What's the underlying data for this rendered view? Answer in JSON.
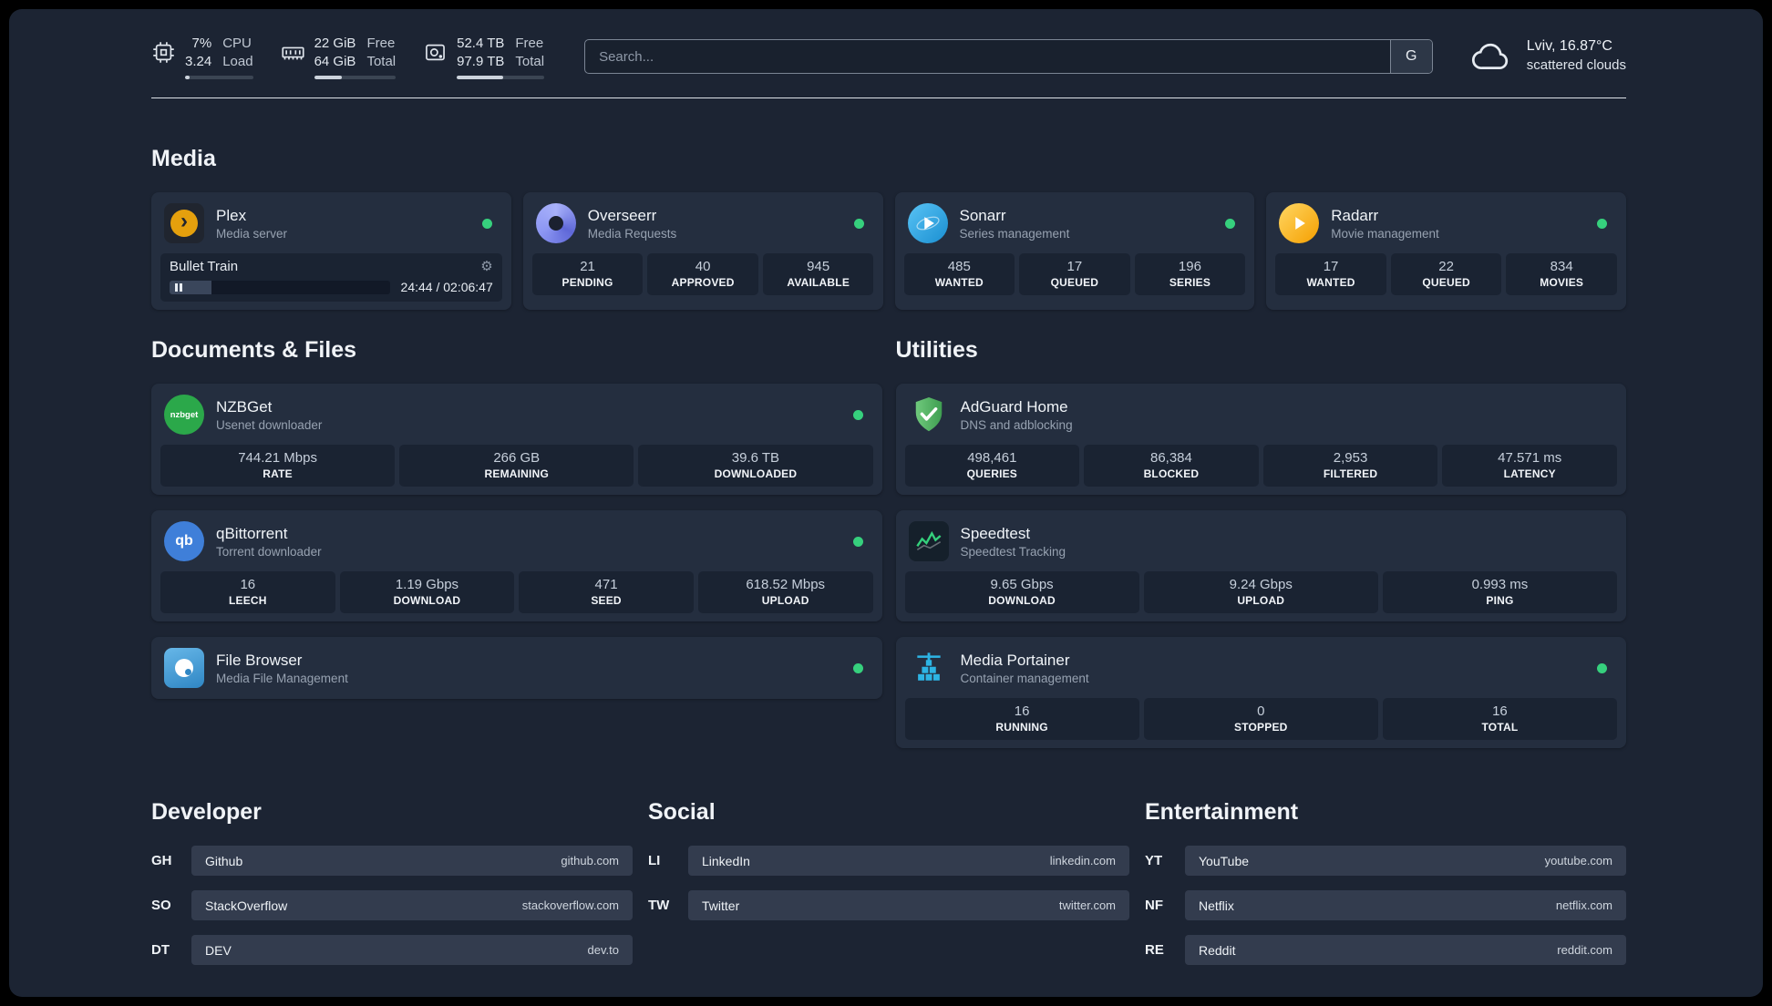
{
  "icons": {
    "plex_chevron": "›",
    "gear": "⚙"
  },
  "colors": {
    "status_online": "#36d07d",
    "plex_accent": "#e5a00d",
    "background": "#1c2433",
    "card": "#242e3f"
  },
  "topbar": {
    "cpu": {
      "value_top": "7%",
      "value_bottom": "3.24",
      "label_top": "CPU",
      "label_bottom": "Load",
      "bar_percent": 7
    },
    "memory": {
      "value_top": "22 GiB",
      "value_bottom": "64 GiB",
      "label_top": "Free",
      "label_bottom": "Total",
      "bar_percent": 34
    },
    "disk": {
      "value_top": "52.4 TB",
      "value_bottom": "97.9 TB",
      "label_top": "Free",
      "label_bottom": "Total",
      "bar_percent": 53
    },
    "search": {
      "placeholder": "Search...",
      "provider_label": "G"
    },
    "weather": {
      "location": "Lviv, 16.87°C",
      "condition": "scattered clouds"
    }
  },
  "sections": {
    "media_title": "Media",
    "documents_title": "Documents & Files",
    "utilities_title": "Utilities"
  },
  "services": {
    "plex": {
      "name": "Plex",
      "subtitle": "Media server",
      "online": true,
      "player": {
        "track": "Bullet Train",
        "time": "24:44 / 02:06:47",
        "progress_percent": 19
      }
    },
    "overseerr": {
      "name": "Overseerr",
      "subtitle": "Media Requests",
      "online": true,
      "stats": [
        {
          "value": "21",
          "label": "PENDING"
        },
        {
          "value": "40",
          "label": "APPROVED"
        },
        {
          "value": "945",
          "label": "AVAILABLE"
        }
      ]
    },
    "sonarr": {
      "name": "Sonarr",
      "subtitle": "Series management",
      "online": true,
      "stats": [
        {
          "value": "485",
          "label": "WANTED"
        },
        {
          "value": "17",
          "label": "QUEUED"
        },
        {
          "value": "196",
          "label": "SERIES"
        }
      ]
    },
    "radarr": {
      "name": "Radarr",
      "subtitle": "Movie management",
      "online": true,
      "stats": [
        {
          "value": "17",
          "label": "WANTED"
        },
        {
          "value": "22",
          "label": "QUEUED"
        },
        {
          "value": "834",
          "label": "MOVIES"
        }
      ]
    },
    "nzbget": {
      "name": "NZBGet",
      "subtitle": "Usenet downloader",
      "online": true,
      "icon_text": "nzbget",
      "stats": [
        {
          "value": "744.21 Mbps",
          "label": "RATE"
        },
        {
          "value": "266 GB",
          "label": "REMAINING"
        },
        {
          "value": "39.6 TB",
          "label": "DOWNLOADED"
        }
      ]
    },
    "qbittorrent": {
      "name": "qBittorrent",
      "subtitle": "Torrent downloader",
      "online": true,
      "icon_text": "qb",
      "stats": [
        {
          "value": "16",
          "label": "LEECH"
        },
        {
          "value": "1.19 Gbps",
          "label": "DOWNLOAD"
        },
        {
          "value": "471",
          "label": "SEED"
        },
        {
          "value": "618.52 Mbps",
          "label": "UPLOAD"
        }
      ]
    },
    "filebrowser": {
      "name": "File Browser",
      "subtitle": "Media File Management",
      "online": true
    },
    "adguard": {
      "name": "AdGuard Home",
      "subtitle": "DNS and adblocking",
      "stats": [
        {
          "value": "498,461",
          "label": "QUERIES"
        },
        {
          "value": "86,384",
          "label": "BLOCKED"
        },
        {
          "value": "2,953",
          "label": "FILTERED"
        },
        {
          "value": "47.571 ms",
          "label": "LATENCY"
        }
      ]
    },
    "speedtest": {
      "name": "Speedtest",
      "subtitle": "Speedtest Tracking",
      "stats": [
        {
          "value": "9.65 Gbps",
          "label": "DOWNLOAD"
        },
        {
          "value": "9.24 Gbps",
          "label": "UPLOAD"
        },
        {
          "value": "0.993 ms",
          "label": "PING"
        }
      ]
    },
    "portainer": {
      "name": "Media Portainer",
      "subtitle": "Container management",
      "online": true,
      "stats": [
        {
          "value": "16",
          "label": "RUNNING"
        },
        {
          "value": "0",
          "label": "STOPPED"
        },
        {
          "value": "16",
          "label": "TOTAL"
        }
      ]
    }
  },
  "bookmarks": {
    "developer": {
      "title": "Developer",
      "items": [
        {
          "abbr": "GH",
          "name": "Github",
          "url": "github.com"
        },
        {
          "abbr": "SO",
          "name": "StackOverflow",
          "url": "stackoverflow.com"
        },
        {
          "abbr": "DT",
          "name": "DEV",
          "url": "dev.to"
        }
      ]
    },
    "social": {
      "title": "Social",
      "items": [
        {
          "abbr": "LI",
          "name": "LinkedIn",
          "url": "linkedin.com"
        },
        {
          "abbr": "TW",
          "name": "Twitter",
          "url": "twitter.com"
        }
      ]
    },
    "entertainment": {
      "title": "Entertainment",
      "items": [
        {
          "abbr": "YT",
          "name": "YouTube",
          "url": "youtube.com"
        },
        {
          "abbr": "NF",
          "name": "Netflix",
          "url": "netflix.com"
        },
        {
          "abbr": "RE",
          "name": "Reddit",
          "url": "reddit.com"
        }
      ]
    }
  }
}
